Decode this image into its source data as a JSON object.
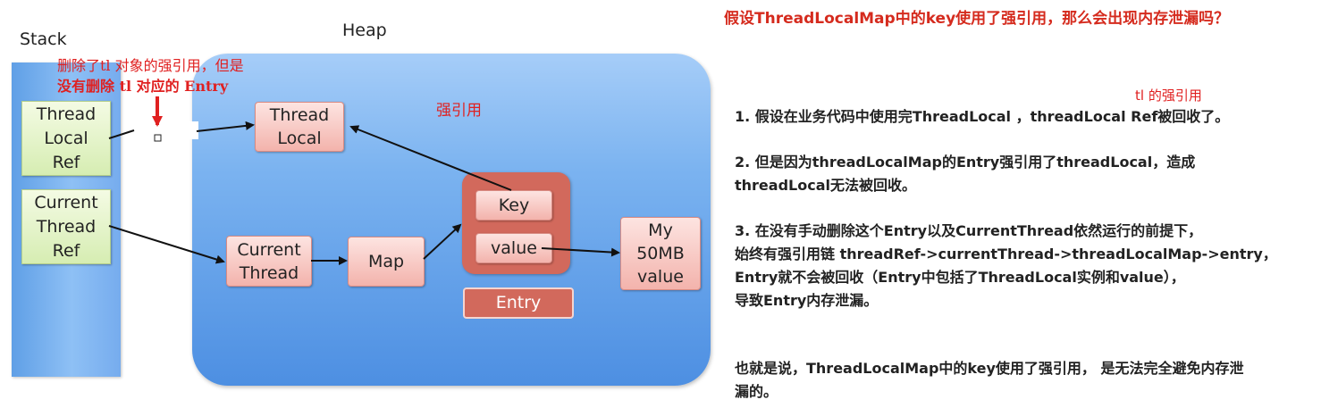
{
  "diagram": {
    "stack_label": "Stack",
    "heap_label": "Heap",
    "stack_boxes": [
      {
        "lines": [
          "Thread",
          "Local",
          "Ref"
        ]
      },
      {
        "lines": [
          "Current",
          "Thread",
          "Ref"
        ]
      }
    ],
    "heap_boxes": {
      "thread_local": [
        "Thread",
        "Local"
      ],
      "current_thread": [
        "Current",
        "Thread"
      ],
      "map": "Map",
      "key": "Key",
      "value": "value",
      "entry": "Entry",
      "my_value": [
        "My",
        "50MB",
        "value"
      ]
    },
    "annotation_deleted": [
      "删除了tl 对象的强引用，但是",
      "没有删除 tl 对应的 Entry"
    ],
    "strong_ref_label": "强引用",
    "tl_strong_ref_label": "tl 的强引用"
  },
  "text": {
    "title": "假设ThreadLocalMap中的key使用了强引用，那么会出现内存泄漏吗？",
    "p1": [
      "1. 假设在业务代码中使用完ThreadLocal ，threadLocal Ref被回收了。"
    ],
    "p2": [
      "2. 但是因为threadLocalMap的Entry强引用了threadLocal，造成",
      "threadLocal无法被回收。"
    ],
    "p3": [
      "3. 在没有手动删除这个Entry以及CurrentThread依然运行的前提下，",
      "始终有强引用链 threadRef->currentThread->threadLocalMap->entry，",
      "Entry就不会被回收（Entry中包括了ThreadLocal实例和value），",
      "导致Entry内存泄漏。"
    ],
    "p4": [
      "也就是说，ThreadLocalMap中的key使用了强引用， 是无法完全避免内存泄",
      "漏的。"
    ]
  },
  "colors": {
    "title_red": "#d52b1e",
    "annotation_red": "#e02020",
    "heap_blue": "#7bb3f0",
    "entry_red": "#d2695c"
  }
}
